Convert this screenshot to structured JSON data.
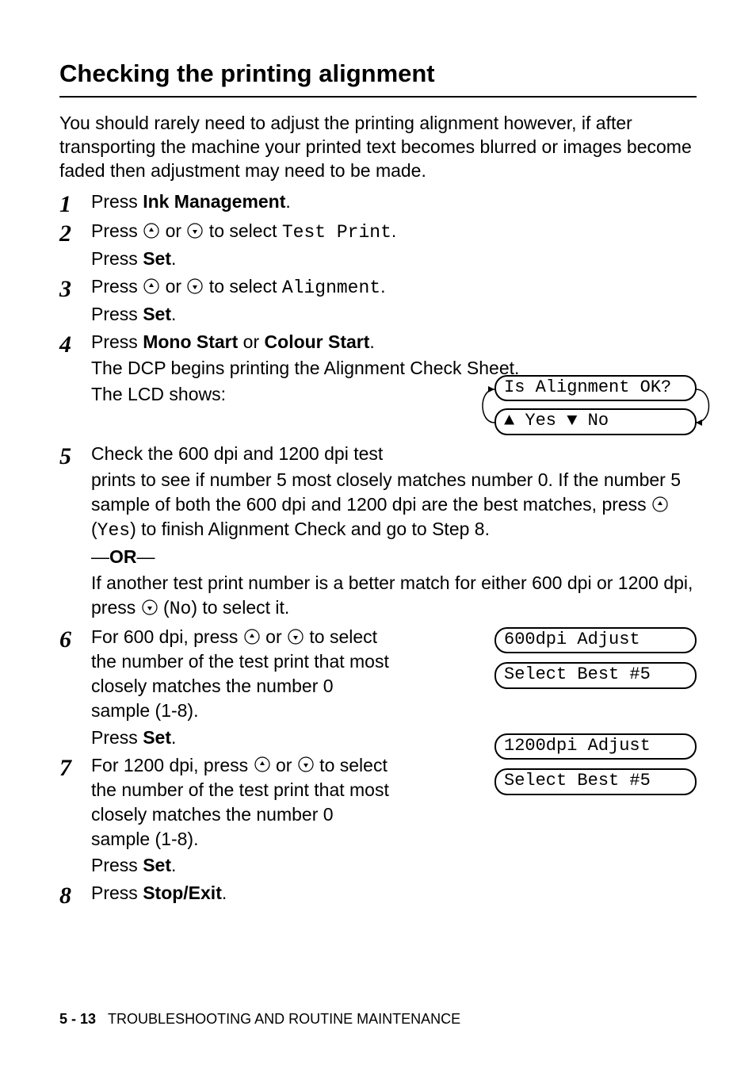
{
  "heading": "Checking the printing alignment",
  "intro": "You should rarely need to adjust the printing alignment however, if after transporting the machine your printed text becomes blurred or images become faded then adjustment may need to be made.",
  "steps": {
    "s1": {
      "press": "Press ",
      "btn": "Ink Management",
      "end": "."
    },
    "s2": {
      "press": "Press ",
      "or": " or ",
      "to_select": " to select ",
      "value": "Test Print",
      "end": ".",
      "press_set_a": "Press ",
      "press_set_b": "Set",
      "press_set_c": "."
    },
    "s3": {
      "press": "Press ",
      "or": " or ",
      "to_select": " to select ",
      "value": "Alignment",
      "end": ".",
      "press_set_a": "Press ",
      "press_set_b": "Set",
      "press_set_c": "."
    },
    "s4": {
      "press": "Press ",
      "mono": "Mono Start",
      "or": " or ",
      "colour": "Colour Start",
      "end": ".",
      "line2": "The DCP begins printing the Alignment Check Sheet.",
      "line3": "The LCD shows:"
    },
    "s5": {
      "l1": "Check the 600 dpi and 1200 dpi test",
      "l2a": "prints to see if number 5 most closely matches number 0. If the number 5 sample of both the 600 dpi and 1200 dpi are the best matches, press ",
      "yes_paren_a": " (",
      "yes": "Yes",
      "yes_paren_b": ") to finish Alignment Check and go to Step 8.",
      "or_label": "OR",
      "l3a": "If another test print number is a better match for either 600 dpi or 1200 dpi, press ",
      "no_paren_a": " (",
      "no": "No",
      "no_paren_b": ") to select it."
    },
    "s6": {
      "a": "For 600 dpi, press ",
      "or": " or ",
      "b": " to select the number of the test print that most closely matches the number 0 sample (1-8).",
      "press_set_a": "Press ",
      "press_set_b": "Set",
      "press_set_c": "."
    },
    "s7": {
      "a": "For 1200 dpi, press ",
      "or": " or ",
      "b": " to select the number of the test print that most closely matches the number 0 sample (1-8).",
      "press_set_a": "Press ",
      "press_set_b": "Set",
      "press_set_c": "."
    },
    "s8": {
      "press": "Press ",
      "btn": "Stop/Exit",
      "end": "."
    }
  },
  "lcd": {
    "alignment_q": "Is Alignment OK?",
    "yes": "Yes",
    "no": "No",
    "adj600": "600dpi Adjust",
    "adj1200": "1200dpi Adjust",
    "select_best": "Select Best #5"
  },
  "footer": {
    "page": "5 - 13",
    "section": "TROUBLESHOOTING AND ROUTINE MAINTENANCE"
  }
}
